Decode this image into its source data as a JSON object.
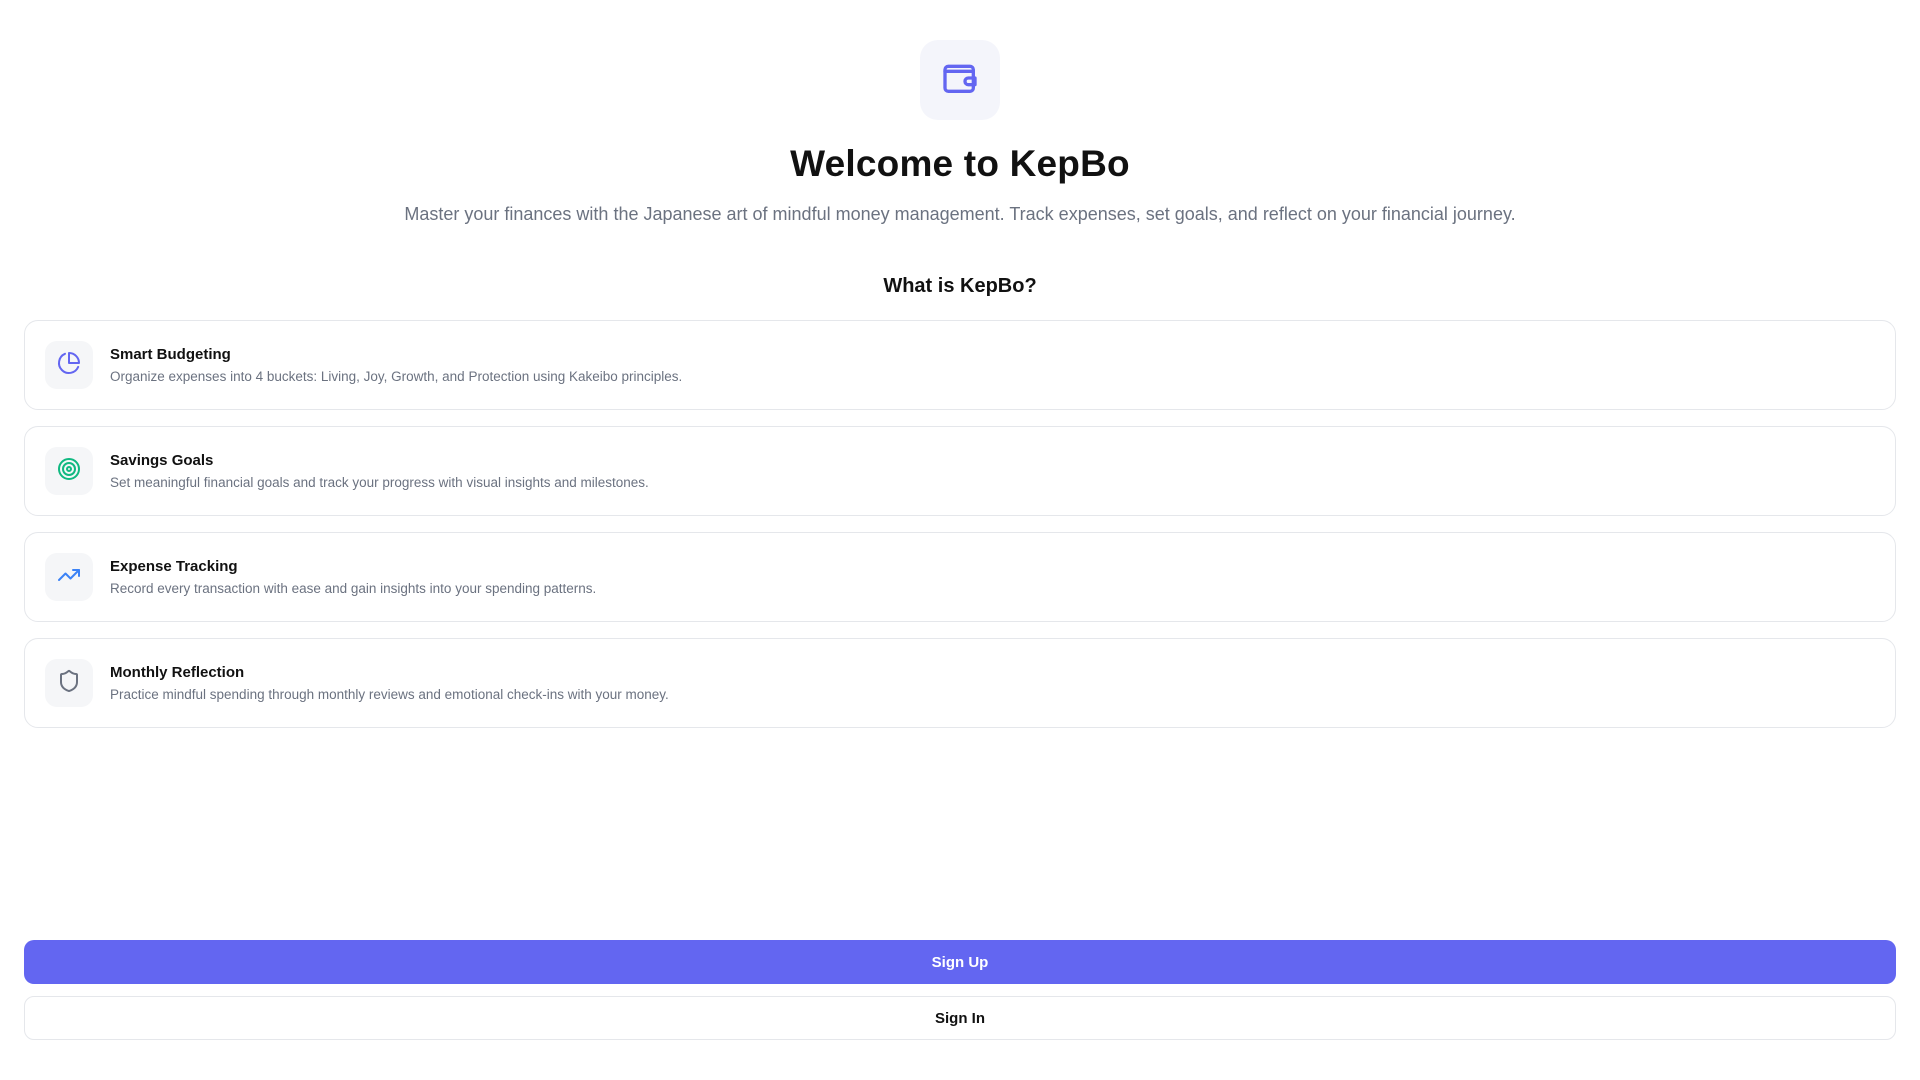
{
  "hero": {
    "logo_icon": "wallet-icon",
    "title": "Welcome to KepBo",
    "subtitle": "Master your finances with the Japanese art of mindful money management. Track expenses, set goals, and reflect on your financial journey."
  },
  "about": {
    "heading": "What is KepBo?"
  },
  "features": [
    {
      "icon": "pie-chart-icon",
      "icon_color": "#6366f1",
      "title": "Smart Budgeting",
      "description": "Organize expenses into 4 buckets: Living, Joy, Growth, and Protection using Kakeibo principles."
    },
    {
      "icon": "target-icon",
      "icon_color": "#10b981",
      "title": "Savings Goals",
      "description": "Set meaningful financial goals and track your progress with visual insights and milestones."
    },
    {
      "icon": "trending-up-icon",
      "icon_color": "#3b82f6",
      "title": "Expense Tracking",
      "description": "Record every transaction with ease and gain insights into your spending patterns."
    },
    {
      "icon": "shield-icon",
      "icon_color": "#6b7280",
      "title": "Monthly Reflection",
      "description": "Practice mindful spending through monthly reviews and emotional check-ins with your money."
    }
  ],
  "actions": {
    "signup_label": "Sign Up",
    "signin_label": "Sign In"
  },
  "colors": {
    "accent": "#6366f1",
    "text": "#111111",
    "muted": "#6b7280",
    "border": "#e5e7eb"
  }
}
